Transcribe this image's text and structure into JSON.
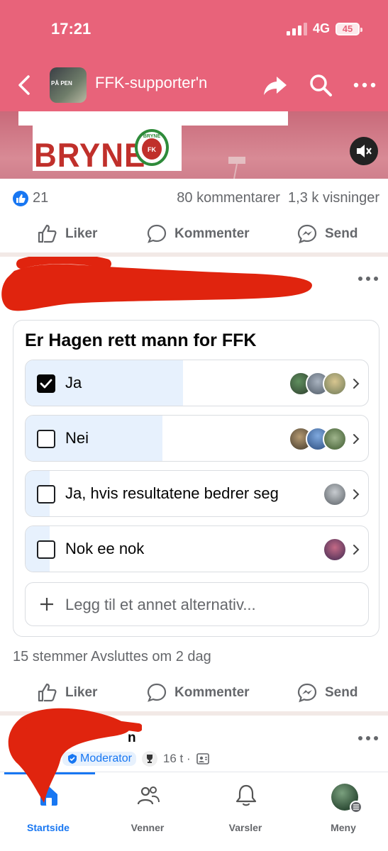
{
  "status_bar": {
    "time": "17:21",
    "network": "4G",
    "battery": "45"
  },
  "header": {
    "group_name": "FFK-supporter'n",
    "avatar_text": "PÅ PEN"
  },
  "video": {
    "sign_text": "BRYNE",
    "crest_text": "BRYNE",
    "crest_sub": "FK"
  },
  "post1": {
    "like_count": "21",
    "comments": "80 kommentarer",
    "views": "1,3 k visninger"
  },
  "actions": {
    "like": "Liker",
    "comment": "Kommenter",
    "send": "Send"
  },
  "poll": {
    "question": "Er Hagen rett mann for FFK",
    "options": [
      {
        "label": "Ja",
        "checked": true,
        "share": 0.46
      },
      {
        "label": "Nei",
        "checked": false,
        "share": 0.4
      },
      {
        "label": "Ja, hvis resultatene bedrer seg",
        "checked": false,
        "share": 0.07
      },
      {
        "label": "Nok ee nok",
        "checked": false,
        "share": 0.07
      }
    ],
    "add_option": "Legg til et annet alternativ...",
    "meta": "15 stemmer Avsluttes om 2 dag"
  },
  "post3": {
    "moderator": "Moderator",
    "time": "16 t ·",
    "name_fragment": "n"
  },
  "tabs": [
    {
      "label": "Startside",
      "icon": "home-icon",
      "active": true
    },
    {
      "label": "Venner",
      "icon": "friends-icon",
      "active": false
    },
    {
      "label": "Varsler",
      "icon": "bell-icon",
      "active": false
    },
    {
      "label": "Meny",
      "icon": "menu-avatar",
      "active": false
    }
  ],
  "colors": {
    "header": "#e8637a",
    "accent": "#1877f2",
    "poll_fill": "#e7f1fd",
    "redaction": "#e0240e"
  }
}
